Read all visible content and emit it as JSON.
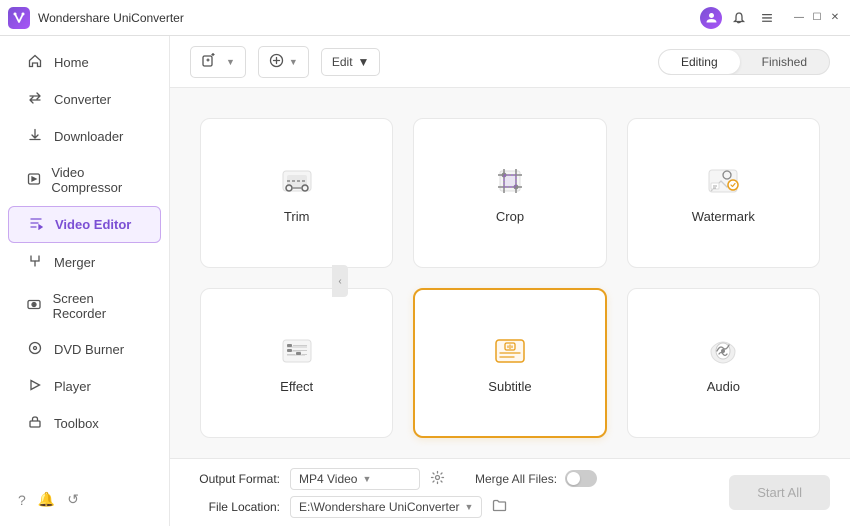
{
  "app": {
    "title": "Wondershare UniConverter",
    "logo_text": "W"
  },
  "titlebar": {
    "icons": [
      "user-icon",
      "bell-icon",
      "menu-icon"
    ],
    "window_controls": [
      "minimize",
      "maximize",
      "close"
    ]
  },
  "sidebar": {
    "items": [
      {
        "id": "home",
        "label": "Home",
        "icon": "⊞"
      },
      {
        "id": "converter",
        "label": "Converter",
        "icon": "⇄"
      },
      {
        "id": "downloader",
        "label": "Downloader",
        "icon": "↓"
      },
      {
        "id": "video-compressor",
        "label": "Video Compressor",
        "icon": "⊡"
      },
      {
        "id": "video-editor",
        "label": "Video Editor",
        "icon": "✦",
        "active": true
      },
      {
        "id": "merger",
        "label": "Merger",
        "icon": "⊕"
      },
      {
        "id": "screen-recorder",
        "label": "Screen Recorder",
        "icon": "⊙"
      },
      {
        "id": "dvd-burner",
        "label": "DVD Burner",
        "icon": "◎"
      },
      {
        "id": "player",
        "label": "Player",
        "icon": "▷"
      },
      {
        "id": "toolbox",
        "label": "Toolbox",
        "icon": "⚙"
      }
    ],
    "bottom_icons": [
      "help",
      "notification",
      "feedback"
    ]
  },
  "toolbar": {
    "add_file_label": "Add Files",
    "add_btn_label": "Add",
    "edit_label": "Edit",
    "tabs": {
      "editing_label": "Editing",
      "finished_label": "Finished",
      "active": "editing"
    }
  },
  "grid": {
    "cards": [
      {
        "id": "trim",
        "label": "Trim"
      },
      {
        "id": "crop",
        "label": "Crop"
      },
      {
        "id": "watermark",
        "label": "Watermark"
      },
      {
        "id": "effect",
        "label": "Effect"
      },
      {
        "id": "subtitle",
        "label": "Subtitle",
        "selected": true
      },
      {
        "id": "audio",
        "label": "Audio"
      }
    ]
  },
  "bottom": {
    "output_format_label": "Output Format:",
    "output_format_value": "MP4 Video",
    "file_location_label": "File Location:",
    "file_location_value": "E:\\Wondershare UniConverter",
    "merge_label": "Merge All Files:",
    "start_all_label": "Start All"
  }
}
